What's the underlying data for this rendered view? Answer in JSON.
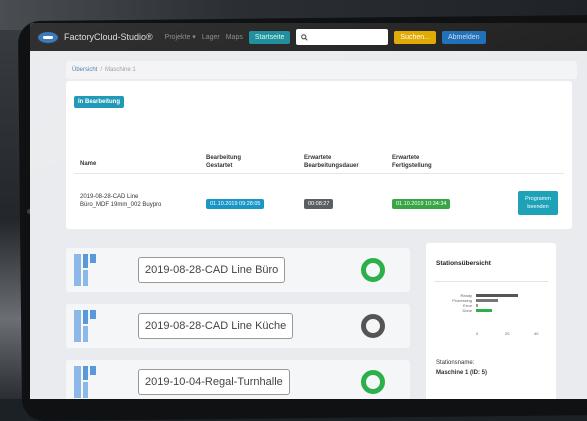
{
  "navbar": {
    "brand": "FactoryCloud-Studio®",
    "links": [
      "Projekte ▾",
      "Lager",
      "Maps"
    ],
    "teal_button": "Startseite",
    "search_icon": "magnifier",
    "yellow_button": "Suchen...",
    "blue_button": "Abmelden"
  },
  "breadcrumb": {
    "parent": "Übersicht",
    "separator": "/",
    "current": "Maschine 1"
  },
  "job": {
    "status_badge": "In Bearbeitung",
    "headers": {
      "name": "Name",
      "started_line1": "Bearbeitung",
      "started_line2": "Gestartet",
      "duration_line1": "Erwartete",
      "duration_line2": "Bearbeitungsdauer",
      "finish_line1": "Erwartete",
      "finish_line2": "Fertigstellung"
    },
    "row": {
      "name_line1": "2019-08-28-CAD Line",
      "name_line2": "Büro_MDF 19mm_002 Buypro",
      "started": "01.10.2019 09:28:05",
      "duration": "00:08:27",
      "finish": "01.10.2019 10:34:34",
      "program_button_line1": "Programm",
      "program_button_line2": "beenden"
    }
  },
  "queue": [
    {
      "name": "2019-08-28-CAD Line Büro",
      "status_color": "#2bb04a"
    },
    {
      "name": "2019-08-28-CAD Line Küche",
      "status_color": "#555555"
    },
    {
      "name": "2019-10-04-Regal-Turnhalle",
      "status_color": "#2bb04a"
    }
  ],
  "station_overview": {
    "title": "Stationsübersicht",
    "chart_legend": [
      "Ready",
      "Processing",
      "Error",
      "Done"
    ],
    "chart_ticks": [
      "0",
      "20",
      "40"
    ],
    "station_name_label": "Stationsname:",
    "station_name_value": "Maschine 1 (ID: 5)"
  },
  "colors": {
    "accent_blue": "#1996c6",
    "success_green": "#3aa547",
    "warning_yellow": "#e0a800",
    "navbar_bg": "#222222"
  }
}
